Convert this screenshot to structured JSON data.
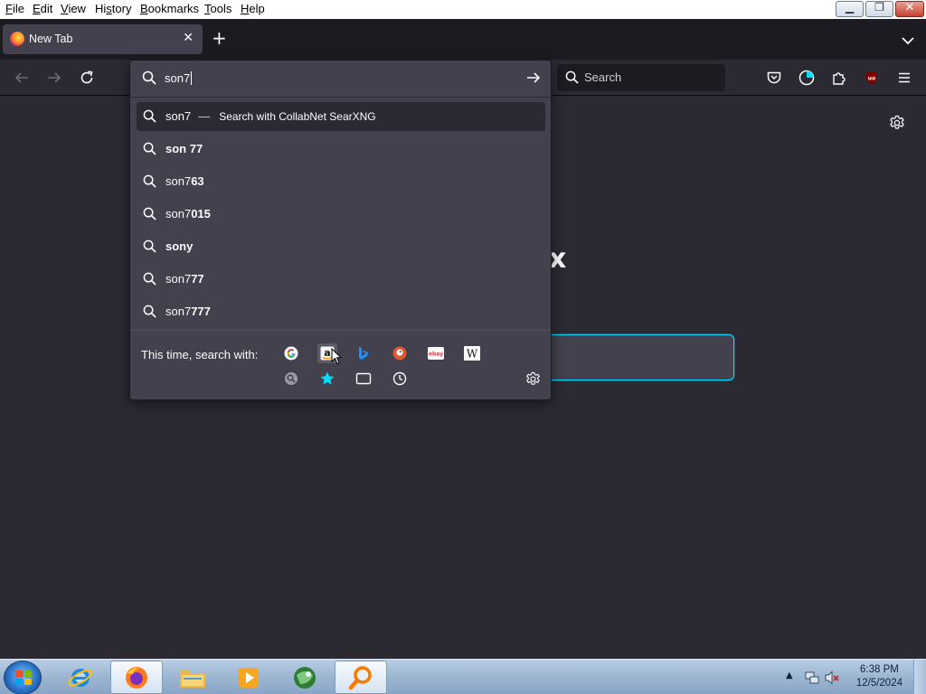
{
  "menubar": {
    "items": [
      {
        "label": "File",
        "key": "F",
        "rest": "ile"
      },
      {
        "label": "Edit",
        "key": "E",
        "rest": "dit"
      },
      {
        "label": "View",
        "key": "V",
        "rest": "iew"
      },
      {
        "label": "History",
        "key": "s",
        "pre": "Hi",
        "rest": "tory"
      },
      {
        "label": "Bookmarks",
        "key": "B",
        "rest": "ookmarks"
      },
      {
        "label": "Tools",
        "key": "T",
        "rest": "ools"
      },
      {
        "label": "Help",
        "key": "H",
        "rest": "elp"
      }
    ],
    "window_buttons": [
      "minimize",
      "restore",
      "close"
    ]
  },
  "tabs": [
    {
      "title": "New Tab",
      "favicon": "firefox-icon",
      "active": true
    }
  ],
  "navbar": {
    "search_placeholder": "Search"
  },
  "urlbar": {
    "value": "son7",
    "suggestions": [
      {
        "typed": "son7",
        "bold": "",
        "action": "Search with CollabNet SearXNG",
        "dash": "—",
        "selected": true
      },
      {
        "typed": "",
        "bold": "son 77",
        "selected": false
      },
      {
        "typed": "son7",
        "bold": "63",
        "selected": false
      },
      {
        "typed": "son7",
        "bold": "015",
        "selected": false
      },
      {
        "typed": "",
        "bold": "sony",
        "selected": false
      },
      {
        "typed": "son7",
        "bold": "77",
        "selected": false
      },
      {
        "typed": "son7",
        "bold": "777",
        "selected": false
      }
    ],
    "oneoff_label": "This time, search with:",
    "engines": [
      {
        "name": "google-icon",
        "hover": false
      },
      {
        "name": "amazon-icon",
        "hover": true
      },
      {
        "name": "bing-icon",
        "hover": false
      },
      {
        "name": "duckduckgo-icon",
        "hover": false
      },
      {
        "name": "ebay-icon",
        "hover": false
      },
      {
        "name": "wikipedia-icon",
        "hover": false
      },
      {
        "name": "searxng-icon",
        "hover": false
      },
      {
        "name": "bookmarks-star-icon",
        "hover": false
      },
      {
        "name": "tabs-icon",
        "hover": false
      },
      {
        "name": "history-icon",
        "hover": false
      }
    ],
    "ebay_text": "ebay",
    "wiki_text": "W",
    "amazon_text": "a"
  },
  "colors": {
    "accent_cyan": "#00ddff",
    "toolbar_bg": "#2b2a33",
    "panel_bg": "#42414d",
    "tabstrip_bg": "#1c1b22"
  },
  "taskbar": {
    "items": [
      "start-button",
      "internet-explorer-icon",
      "firefox-icon",
      "file-explorer-icon",
      "media-player-icon",
      "app-globe-icon",
      "search-magnifier-icon"
    ],
    "time": "6:38 PM",
    "date": "12/5/2024"
  }
}
